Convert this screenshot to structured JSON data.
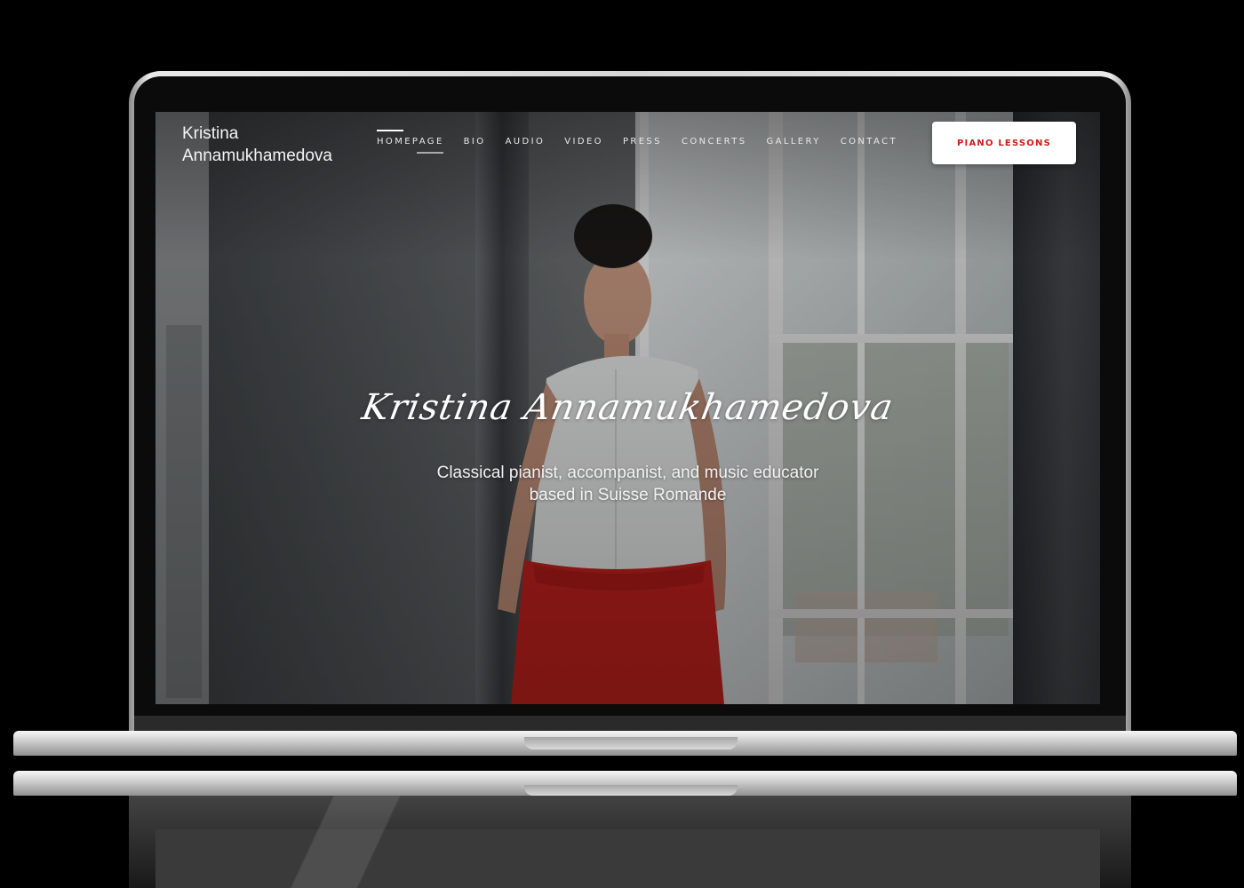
{
  "site": {
    "brand": "Kristina\nAnnamukhamedova",
    "nav": [
      {
        "label": "HOMEPAGE",
        "active": true
      },
      {
        "label": "BIO",
        "active": false
      },
      {
        "label": "AUDIO",
        "active": false
      },
      {
        "label": "VIDEO",
        "active": false
      },
      {
        "label": "PRESS",
        "active": false
      },
      {
        "label": "CONCERTS",
        "active": false
      },
      {
        "label": "GALLERY",
        "active": false
      },
      {
        "label": "CONTACT",
        "active": false
      }
    ],
    "cta_label": "PIANO LESSONS"
  },
  "hero": {
    "name": "Kristina Annamukhamedova",
    "subtitle": "Classical pianist, accompanist, and music educator\nbased in Suisse Romande"
  },
  "colors": {
    "accent": "#d21a1a",
    "cta_background": "#ffffff",
    "pants": "#c8231f",
    "blouse": "#e9ebea"
  }
}
